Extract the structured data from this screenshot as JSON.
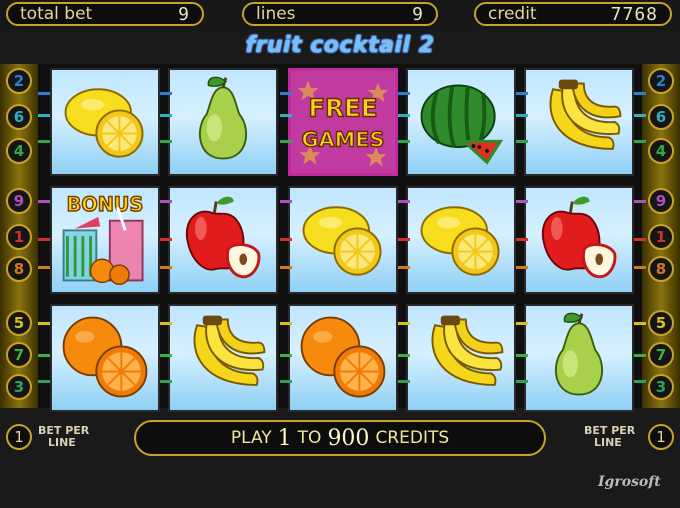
{
  "header": {
    "total_bet_label": "total bet",
    "total_bet_value": "9",
    "lines_label": "lines",
    "lines_value": "9",
    "credit_label": "credit",
    "credit_value": "7768"
  },
  "game_title": "fruit cocktail 2",
  "line_badges_left": [
    "2",
    "6",
    "4",
    "9",
    "1",
    "8",
    "5",
    "7",
    "3"
  ],
  "line_badges_right": [
    "2",
    "6",
    "4",
    "9",
    "1",
    "8",
    "5",
    "7",
    "3"
  ],
  "badge_colors": {
    "2": "#2f7fd0",
    "6": "#2fb0c0",
    "4": "#2fa84a",
    "9": "#b050c0",
    "1": "#d03030",
    "8": "#d07a20",
    "5": "#d8c020",
    "7": "#40b040",
    "3": "#30a060"
  },
  "reels": [
    [
      "lemon",
      "bonus",
      "orange"
    ],
    [
      "pear",
      "apple",
      "banana"
    ],
    [
      "free-games",
      "lemon",
      "orange"
    ],
    [
      "watermelon",
      "lemon",
      "banana"
    ],
    [
      "banana",
      "apple",
      "pear"
    ]
  ],
  "bonus_label": "BONUS",
  "free_games_label_1": "FREE",
  "free_games_label_2": "GAMES",
  "bottom": {
    "left_bet_value": "1",
    "left_bet_label_1": "BET PER",
    "left_bet_label_2": "LINE",
    "right_bet_value": "1",
    "right_bet_label_1": "BET PER",
    "right_bet_label_2": "LINE",
    "play_prefix": "PLAY",
    "play_min": "1",
    "play_to": "TO",
    "play_max": "900",
    "play_suffix": "CREDITS"
  },
  "brand": "Igrosoft"
}
